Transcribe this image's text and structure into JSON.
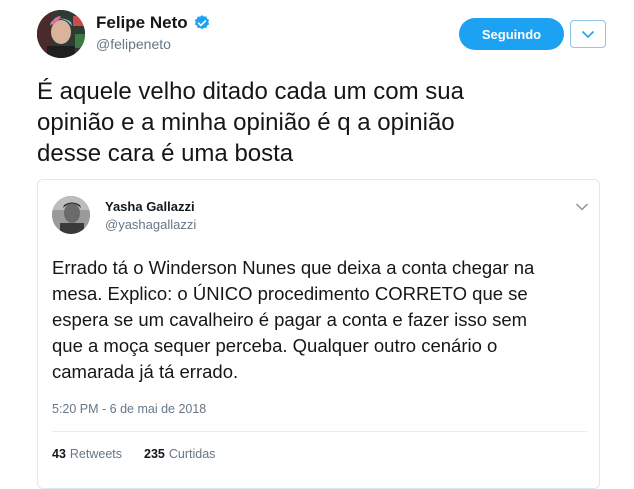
{
  "author": {
    "name": "Felipe Neto",
    "handle": "@felipeneto",
    "verified": true,
    "avatar_icon": "user-avatar"
  },
  "actions": {
    "follow_label": "Seguindo",
    "caret_icon": "chevron-down-icon"
  },
  "tweet": {
    "text": "É aquele velho ditado cada um com sua\nopinião e a minha opinião é q a opinião\ndesse cara é uma bosta"
  },
  "quoted": {
    "name": "Yasha Gallazzi",
    "handle": "@yashagallazzi",
    "text": "Errado tá o Winderson Nunes que deixa a conta chegar na\nmesa. Explico: o ÚNICO procedimento CORRETO que se\nespera se um cavalheiro é pagar a conta e fazer isso sem\nque a moça sequer perceba. Qualquer outro cenário o\ncamarada já tá errado.",
    "timestamp": "5:20 PM - 6 de mai de 2018",
    "retweets_count": "43",
    "retweets_label": "Retweets",
    "likes_count": "235",
    "likes_label": "Curtidas"
  },
  "colors": {
    "accent": "#1da1f2",
    "muted": "#657786",
    "text": "#14171a",
    "border": "#e1e8ed"
  }
}
